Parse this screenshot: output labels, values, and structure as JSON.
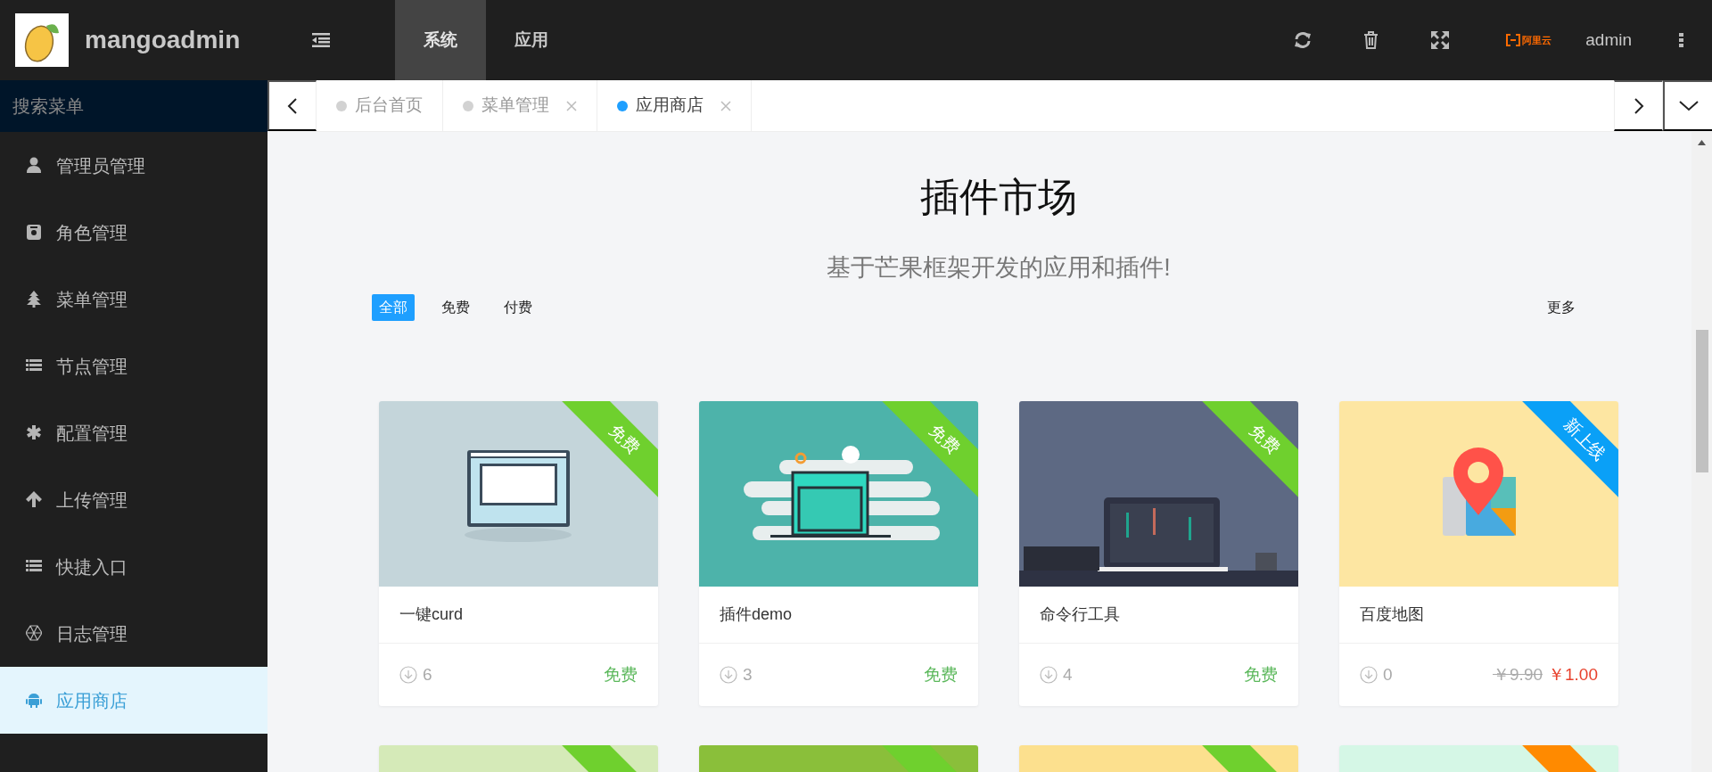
{
  "header": {
    "brand": "mangoadmin",
    "modules": [
      {
        "label": "系统",
        "selected": true
      },
      {
        "label": "应用",
        "selected": false
      }
    ],
    "brand_mark": "阿里云",
    "user": "admin"
  },
  "sidebar": {
    "search": {
      "placeholder": "搜索菜单"
    },
    "items": [
      {
        "label": "管理员管理",
        "selected": false
      },
      {
        "label": "角色管理",
        "selected": false
      },
      {
        "label": "菜单管理",
        "selected": false
      },
      {
        "label": "节点管理",
        "selected": false
      },
      {
        "label": "配置管理",
        "selected": false
      },
      {
        "label": "上传管理",
        "selected": false
      },
      {
        "label": "快捷入口",
        "selected": false
      },
      {
        "label": "日志管理",
        "selected": false
      },
      {
        "label": "应用商店",
        "selected": true
      }
    ]
  },
  "tabs": [
    {
      "label": "后台首页",
      "selected": false,
      "closable": false
    },
    {
      "label": "菜单管理",
      "selected": false,
      "closable": true
    },
    {
      "label": "应用商店",
      "selected": true,
      "closable": true
    }
  ],
  "market": {
    "title": "插件市场",
    "subtitle": "基于芒果框架开发的应用和插件!",
    "filters": [
      {
        "label": "全部",
        "selected": true
      },
      {
        "label": "免费",
        "selected": false
      },
      {
        "label": "付费",
        "selected": false
      }
    ],
    "more": "更多"
  },
  "cards": [
    {
      "title": "一键curd",
      "ribbon": {
        "label": "免费",
        "color": "#6fd02e"
      },
      "downloads": "6",
      "price": {
        "kind": "free",
        "label": "免费"
      }
    },
    {
      "title": "插件demo",
      "ribbon": {
        "label": "免费",
        "color": "#6fd02e"
      },
      "downloads": "3",
      "price": {
        "kind": "free",
        "label": "免费"
      }
    },
    {
      "title": "命令行工具",
      "ribbon": {
        "label": "免费",
        "color": "#6fd02e"
      },
      "downloads": "4",
      "price": {
        "kind": "free",
        "label": "免费"
      }
    },
    {
      "title": "百度地图",
      "ribbon": {
        "label": "新上线",
        "color": "#0aa0f7"
      },
      "downloads": "0",
      "price": {
        "kind": "discount",
        "old": "￥9.90",
        "label": "￥1.00"
      }
    }
  ],
  "partial_cards": [
    {
      "ribbon": {
        "color": "#6fd02e"
      }
    },
    {
      "ribbon": {
        "color": "#6fd02e"
      }
    },
    {
      "ribbon": {
        "color": "#6fd02e"
      }
    },
    {
      "ribbon": {
        "color": "#ff8a00"
      }
    }
  ]
}
